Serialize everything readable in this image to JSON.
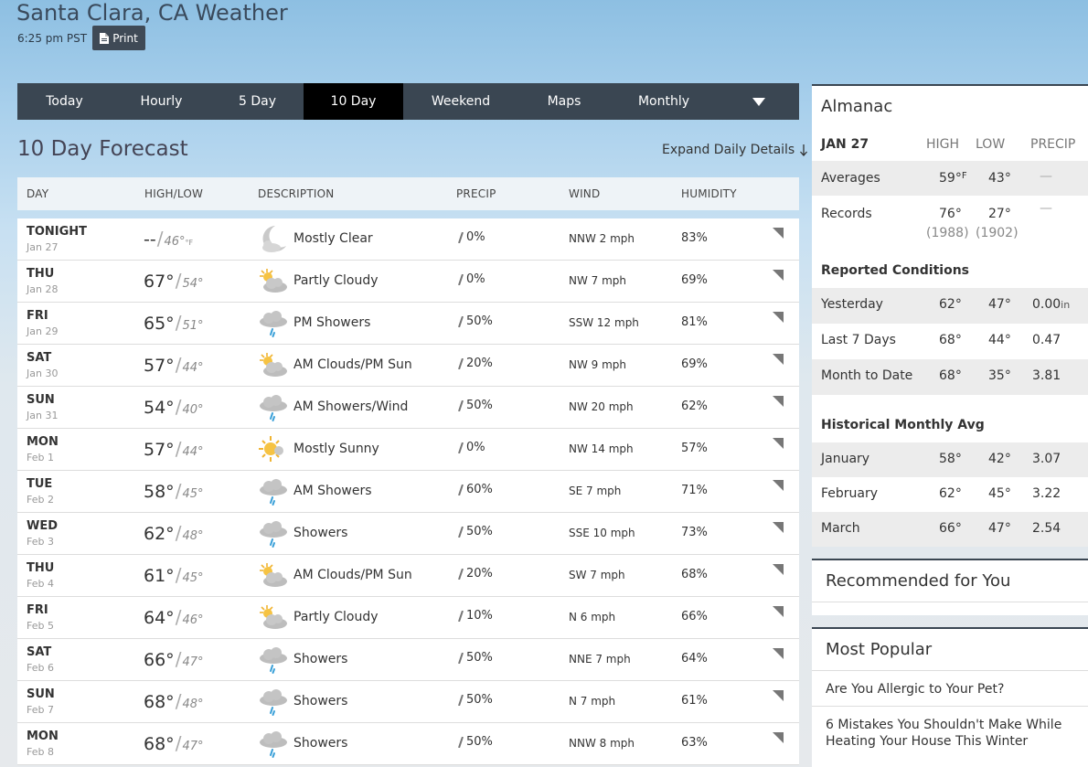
{
  "header": {
    "title": "Santa Clara, CA Weather",
    "time": "6:25 pm PST",
    "print_label": "Print"
  },
  "tabs": [
    {
      "label": "Today",
      "active": false
    },
    {
      "label": "Hourly",
      "active": false
    },
    {
      "label": "5 Day",
      "active": false
    },
    {
      "label": "10 Day",
      "active": true
    },
    {
      "label": "Weekend",
      "active": false
    },
    {
      "label": "Maps",
      "active": false
    },
    {
      "label": "Monthly",
      "active": false
    }
  ],
  "forecast": {
    "heading": "10 Day Forecast",
    "expand_label": "Expand Daily Details",
    "columns": [
      "DAY",
      "HIGH/LOW",
      "DESCRIPTION",
      "PRECIP",
      "WIND",
      "HUMIDITY"
    ],
    "temp_unit": "°F",
    "rows": [
      {
        "day": "TONIGHT",
        "date": "Jan 27",
        "high": "--",
        "low": "46°",
        "icon": "moon-cloud-icon",
        "desc": "Mostly Clear",
        "precip": "0%",
        "wind": "NNW 2 mph",
        "humidity": "83%"
      },
      {
        "day": "THU",
        "date": "Jan 28",
        "high": "67°",
        "low": "54°",
        "icon": "partly-cloudy-icon",
        "desc": "Partly Cloudy",
        "precip": "0%",
        "wind": "NW 7 mph",
        "humidity": "69%"
      },
      {
        "day": "FRI",
        "date": "Jan 29",
        "high": "65°",
        "low": "51°",
        "icon": "showers-icon",
        "desc": "PM Showers",
        "precip": "50%",
        "wind": "SSW 12 mph",
        "humidity": "81%"
      },
      {
        "day": "SAT",
        "date": "Jan 30",
        "high": "57°",
        "low": "44°",
        "icon": "partly-cloudy-icon",
        "desc": "AM Clouds/PM Sun",
        "precip": "20%",
        "wind": "NW 9 mph",
        "humidity": "69%"
      },
      {
        "day": "SUN",
        "date": "Jan 31",
        "high": "54°",
        "low": "40°",
        "icon": "showers-icon",
        "desc": "AM Showers/Wind",
        "precip": "50%",
        "wind": "NW 20 mph",
        "humidity": "62%"
      },
      {
        "day": "MON",
        "date": "Feb 1",
        "high": "57°",
        "low": "44°",
        "icon": "sun-icon",
        "desc": "Mostly Sunny",
        "precip": "0%",
        "wind": "NW 14 mph",
        "humidity": "57%"
      },
      {
        "day": "TUE",
        "date": "Feb 2",
        "high": "58°",
        "low": "45°",
        "icon": "showers-icon",
        "desc": "AM Showers",
        "precip": "60%",
        "wind": "SE 7 mph",
        "humidity": "71%"
      },
      {
        "day": "WED",
        "date": "Feb 3",
        "high": "62°",
        "low": "48°",
        "icon": "showers-icon",
        "desc": "Showers",
        "precip": "50%",
        "wind": "SSE 10 mph",
        "humidity": "73%"
      },
      {
        "day": "THU",
        "date": "Feb 4",
        "high": "61°",
        "low": "45°",
        "icon": "partly-cloudy-icon",
        "desc": "AM Clouds/PM Sun",
        "precip": "20%",
        "wind": "SW 7 mph",
        "humidity": "68%"
      },
      {
        "day": "FRI",
        "date": "Feb 5",
        "high": "64°",
        "low": "46°",
        "icon": "partly-cloudy-icon",
        "desc": "Partly Cloudy",
        "precip": "10%",
        "wind": "N 6 mph",
        "humidity": "66%"
      },
      {
        "day": "SAT",
        "date": "Feb 6",
        "high": "66°",
        "low": "47°",
        "icon": "showers-icon",
        "desc": "Showers",
        "precip": "50%",
        "wind": "NNE 7 mph",
        "humidity": "64%"
      },
      {
        "day": "SUN",
        "date": "Feb 7",
        "high": "68°",
        "low": "48°",
        "icon": "showers-icon",
        "desc": "Showers",
        "precip": "50%",
        "wind": "N 7 mph",
        "humidity": "61%"
      },
      {
        "day": "MON",
        "date": "Feb 8",
        "high": "68°",
        "low": "47°",
        "icon": "showers-icon",
        "desc": "Showers",
        "precip": "50%",
        "wind": "NNW 8 mph",
        "humidity": "63%"
      }
    ]
  },
  "almanac": {
    "title": "Almanac",
    "date": "JAN 27",
    "col_high": "HIGH",
    "col_low": "LOW",
    "col_precip": "PRECIP",
    "averages": {
      "label": "Averages",
      "high": "59°",
      "high_unit": "F",
      "low": "43°",
      "precip": "—"
    },
    "records": {
      "label": "Records",
      "high": "76°",
      "high_year": "(1988)",
      "low": "27°",
      "low_year": "(1902)",
      "precip": "—"
    },
    "reported_title": "Reported Conditions",
    "reported": [
      {
        "label": "Yesterday",
        "high": "62°",
        "low": "47°",
        "precip": "0.00",
        "unit": "in"
      },
      {
        "label": "Last 7 Days",
        "high": "68°",
        "low": "44°",
        "precip": "0.47",
        "unit": ""
      },
      {
        "label": "Month to Date",
        "high": "68°",
        "low": "35°",
        "precip": "3.81",
        "unit": ""
      }
    ],
    "historical_title": "Historical Monthly Avg",
    "historical": [
      {
        "label": "January",
        "high": "58°",
        "low": "42°",
        "precip": "3.07"
      },
      {
        "label": "February",
        "high": "62°",
        "low": "45°",
        "precip": "3.22"
      },
      {
        "label": "March",
        "high": "66°",
        "low": "47°",
        "precip": "2.54"
      }
    ]
  },
  "recommended": {
    "title": "Recommended for You"
  },
  "popular": {
    "title": "Most Popular",
    "items": [
      "Are You Allergic to Your Pet?",
      "6 Mistakes You Shouldn't Make While Heating Your House This Winter"
    ]
  }
}
